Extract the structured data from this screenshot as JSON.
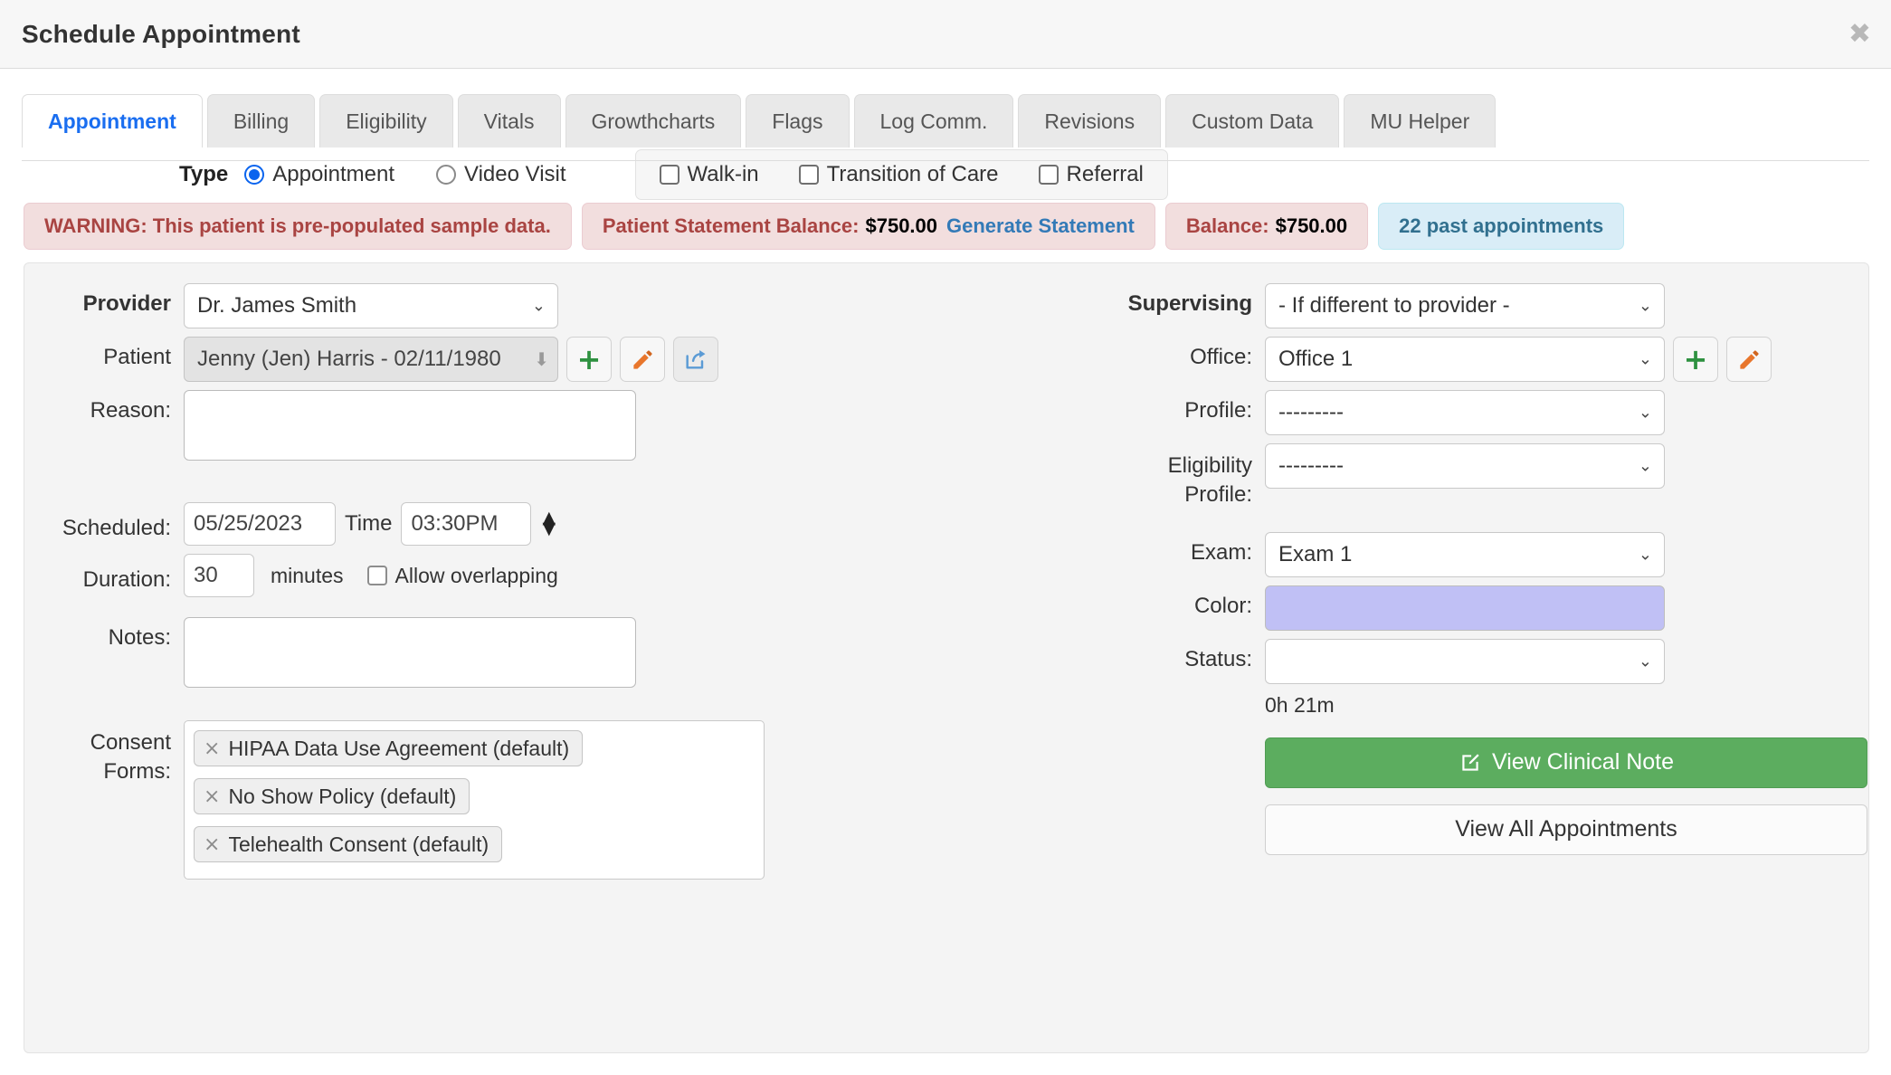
{
  "modal": {
    "title": "Schedule Appointment",
    "close_icon": "close-icon",
    "close_glyph": "✖"
  },
  "tabs": [
    {
      "label": "Appointment",
      "active": true
    },
    {
      "label": "Billing",
      "active": false
    },
    {
      "label": "Eligibility",
      "active": false
    },
    {
      "label": "Vitals",
      "active": false
    },
    {
      "label": "Growthcharts",
      "active": false
    },
    {
      "label": "Flags",
      "active": false
    },
    {
      "label": "Log Comm.",
      "active": false
    },
    {
      "label": "Revisions",
      "active": false
    },
    {
      "label": "Custom Data",
      "active": false
    },
    {
      "label": "MU Helper",
      "active": false
    }
  ],
  "type_row": {
    "label": "Type",
    "radios": [
      {
        "label": "Appointment",
        "checked": true
      },
      {
        "label": "Video Visit",
        "checked": false
      }
    ],
    "checkboxes": [
      {
        "label": "Walk-in",
        "checked": false
      },
      {
        "label": "Transition of Care",
        "checked": false
      },
      {
        "label": "Referral",
        "checked": false
      }
    ]
  },
  "alerts": {
    "warning": "WARNING: This patient is pre-populated sample data.",
    "statement_label": "Patient Statement Balance:",
    "statement_amount": "$750.00",
    "generate_statement_link": "Generate Statement",
    "balance_label": "Balance:",
    "balance_amount": "$750.00",
    "past_appointments": "22 past appointments"
  },
  "form_left": {
    "provider_label": "Provider",
    "provider_value": "Dr. James Smith",
    "patient_label": "Patient",
    "patient_value": "Jenny (Jen) Harris - 02/11/1980",
    "patient_add_icon": "plus-icon",
    "patient_edit_icon": "pencil-icon",
    "patient_share_icon": "share-icon",
    "reason_label": "Reason:",
    "reason_value": "",
    "scheduled_label": "Scheduled:",
    "scheduled_date": "05/25/2023",
    "time_label": "Time",
    "time_value": "03:30PM",
    "duration_label": "Duration:",
    "duration_value": "30",
    "minutes_label": "minutes",
    "allow_overlapping_label": "Allow overlapping",
    "allow_overlapping_checked": false,
    "notes_label": "Notes:",
    "notes_value": "",
    "consent_label_line1": "Consent",
    "consent_label_line2": "Forms:",
    "consent_chips": [
      "HIPAA Data Use Agreement (default)",
      "No Show Policy (default)",
      "Telehealth Consent (default)"
    ],
    "chip_remove_glyph": "×"
  },
  "form_right": {
    "supervising_label": "Supervising",
    "supervising_value": "- If different to provider -",
    "office_label": "Office:",
    "office_value": "Office 1",
    "office_add_icon": "plus-icon",
    "office_edit_icon": "pencil-icon",
    "profile_label": "Profile:",
    "profile_value": "---------",
    "eligibility_label_line1": "Eligibility",
    "eligibility_label_line2": "Profile:",
    "eligibility_value": "---------",
    "exam_label": "Exam:",
    "exam_value": "Exam 1",
    "color_label": "Color:",
    "color_value": "#c0c0f5",
    "status_label": "Status:",
    "status_value": "",
    "duration_text": "0h 21m",
    "view_clinical_note_label": "View Clinical Note",
    "view_clinical_note_icon": "edit-note-icon",
    "view_all_appointments_label": "View All Appointments"
  },
  "colors": {
    "tab_active_text": "#1a6ef0",
    "alert_danger_bg": "#f2dede",
    "alert_danger_text": "#a94442",
    "alert_info_bg": "#d9edf7",
    "alert_info_text": "#31708f",
    "link": "#337ab7",
    "green_button": "#5cad5f",
    "appointment_color": "#c0c0f5"
  },
  "icons": {
    "chevron_down": "⌄",
    "spinner_up": "▲",
    "spinner_down": "▼"
  }
}
